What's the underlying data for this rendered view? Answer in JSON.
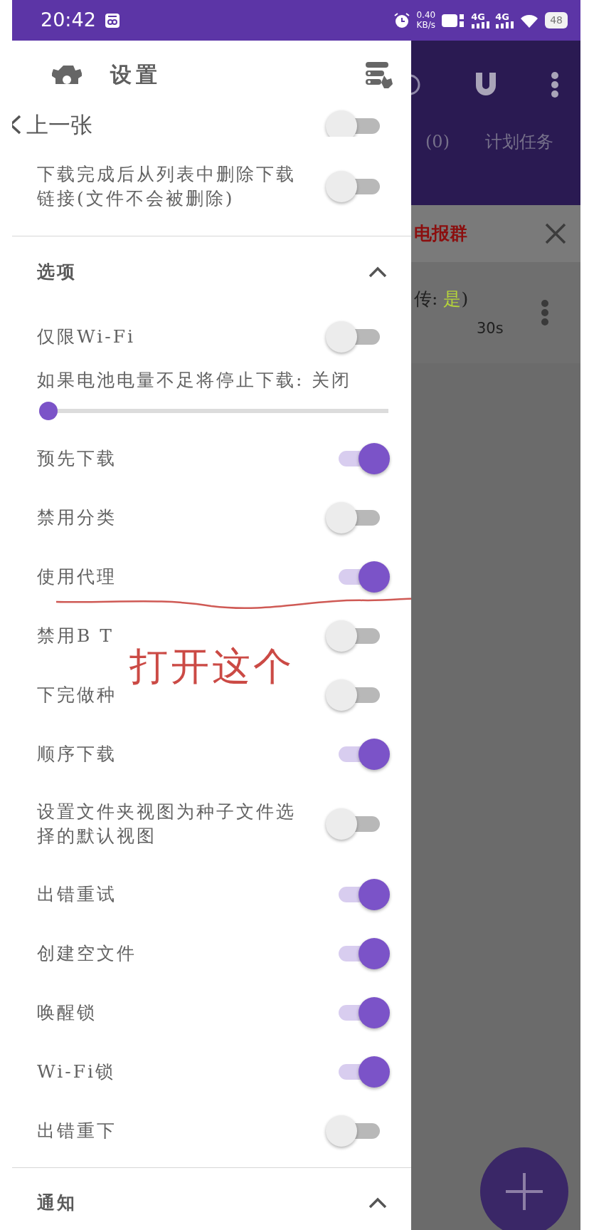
{
  "status_bar": {
    "time": "20:42",
    "speed": "0.40",
    "speed_unit": "KB/s",
    "network": [
      "4G",
      "4G"
    ],
    "battery": "48"
  },
  "drawer": {
    "title": "设置",
    "back_link": "上一张",
    "hidden_row": {
      "on": false
    },
    "rows": [
      {
        "label": "下载完成后从列表中删除下载链接(文件不会被删除)",
        "on": false
      }
    ],
    "sections": [
      {
        "title": "选项",
        "expanded": true,
        "items": [
          {
            "kind": "toggle",
            "label": "仅限Wi-Fi",
            "on": false
          },
          {
            "kind": "slider",
            "label": "如果电池电量不足将停止下载: 关闭",
            "level": 0
          },
          {
            "kind": "toggle",
            "label": "预先下载",
            "on": true
          },
          {
            "kind": "toggle",
            "label": "禁用分类",
            "on": false
          },
          {
            "kind": "toggle",
            "label": "使用代理",
            "on": true
          },
          {
            "kind": "toggle",
            "label": "禁用B T",
            "on": false
          },
          {
            "kind": "toggle",
            "label": "下完做种",
            "on": false
          },
          {
            "kind": "toggle",
            "label": "顺序下载",
            "on": true
          },
          {
            "kind": "toggle",
            "label": "设置文件夹视图为种子文件选择的默认视图",
            "on": false
          },
          {
            "kind": "toggle",
            "label": "出错重试",
            "on": true
          },
          {
            "kind": "toggle",
            "label": "创建空文件",
            "on": true
          },
          {
            "kind": "toggle",
            "label": "唤醒锁",
            "on": true
          },
          {
            "kind": "toggle",
            "label": "Wi-Fi锁",
            "on": true
          },
          {
            "kind": "toggle",
            "label": "出错重下",
            "on": false
          }
        ]
      },
      {
        "title": "通知",
        "expanded": true
      }
    ]
  },
  "annotation": {
    "text": "打开这个"
  },
  "background": {
    "tabs": [
      "(0)",
      "计划任务"
    ],
    "banner": "电报群",
    "task": {
      "status_prefix": "传: ",
      "status_value": "是",
      "status_suffix": ")",
      "time": "30s"
    }
  }
}
